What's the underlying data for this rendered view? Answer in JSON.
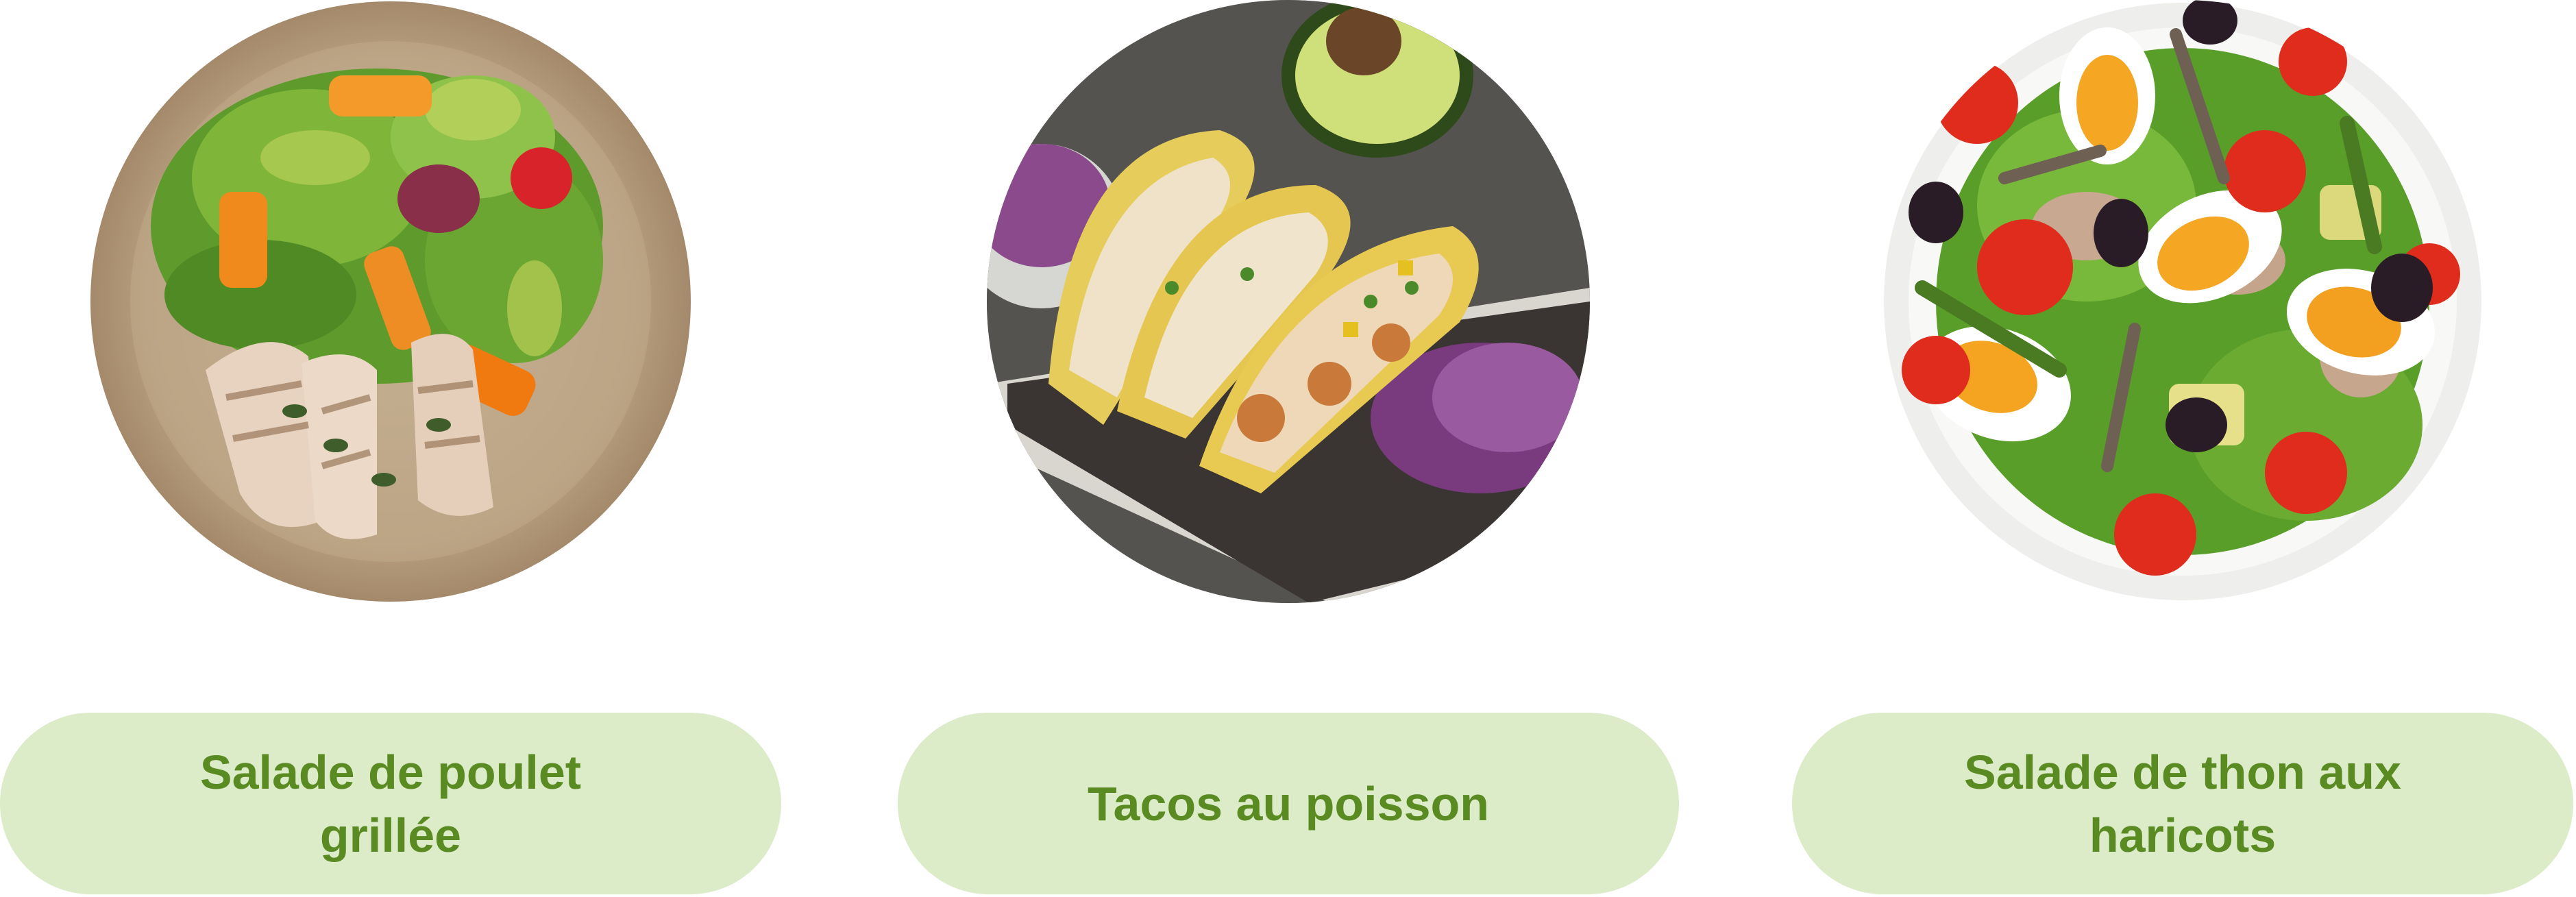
{
  "colors": {
    "label_background": "#dcebc8",
    "label_text": "#5a8a22",
    "page_background": "#ffffff"
  },
  "dishes": [
    {
      "title": "Salade de poulet grillée",
      "image_icon": "grilled-chicken-salad-photo"
    },
    {
      "title": "Tacos au poisson",
      "image_icon": "fish-tacos-photo"
    },
    {
      "title": "Salade de thon aux haricots",
      "image_icon": "tuna-bean-salad-photo"
    }
  ]
}
